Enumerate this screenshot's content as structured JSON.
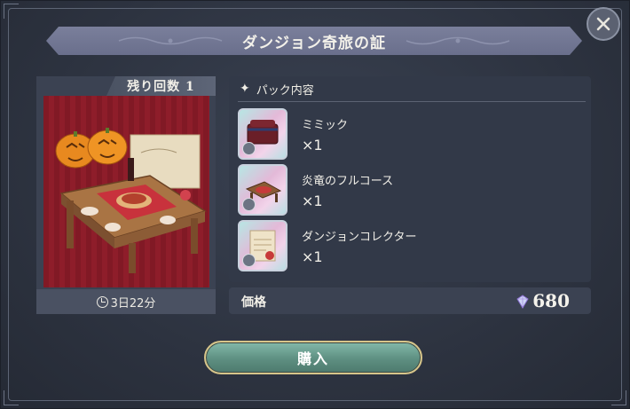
{
  "dialog": {
    "title": "ダンジョン奇旅の証",
    "close_icon": "close-icon"
  },
  "pack": {
    "remaining_label": "残り回数 1",
    "timer_icon": "clock-icon",
    "timer_text": "3日22分",
    "image_icon": "halloween-feast-table-image"
  },
  "contents": {
    "header_icon": "sparkle-icon",
    "header_label": "パック内容",
    "items": [
      {
        "name": "ミミック",
        "qty": "×1",
        "icon": "mimic-chest-icon"
      },
      {
        "name": "炎竜のフルコース",
        "qty": "×1",
        "icon": "dragon-feast-table-icon"
      },
      {
        "name": "ダンジョンコレクター",
        "qty": "×1",
        "icon": "collector-scroll-icon"
      }
    ]
  },
  "price": {
    "label": "価格",
    "icon": "gem-icon",
    "value": "680"
  },
  "buy": {
    "label": "購入"
  },
  "colors": {
    "banner": "#6a6f8c",
    "panel": "#3b4252",
    "buy_button": "#5e8f81",
    "buy_border": "#d7c58a"
  }
}
